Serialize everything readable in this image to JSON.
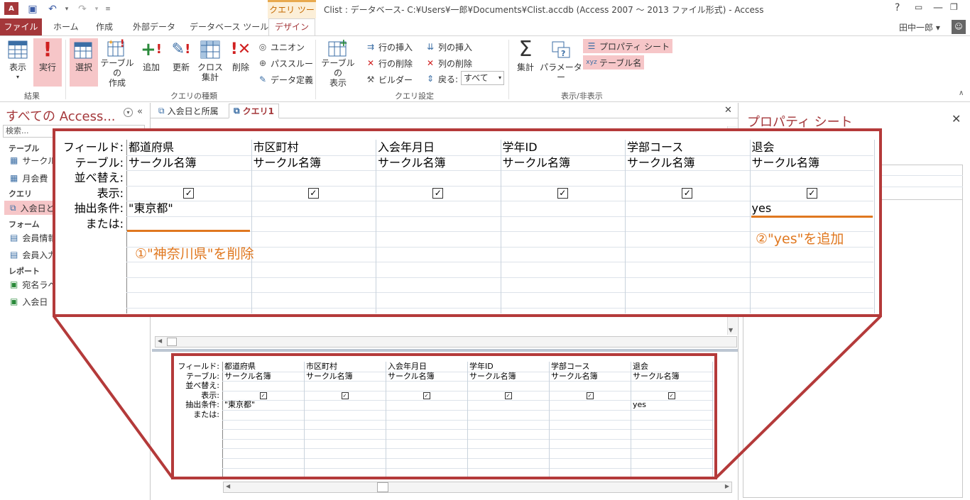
{
  "titlebar": {
    "context_tab": "クエリ ツール",
    "title": "Clist : データベース- C:¥Users¥一郎¥Documents¥Clist.accdb (Access 2007 ～ 2013 ファイル形式) - Access",
    "help": "?",
    "user": "田中一郎"
  },
  "ribbon_tabs": [
    "ファイル",
    "ホーム",
    "作成",
    "外部データ",
    "データベース ツール",
    "デザイン"
  ],
  "ribbon": {
    "groups": {
      "results": "結果",
      "query_type": "クエリの種類",
      "query_setup": "クエリ設定",
      "show_hide": "表示/非表示"
    },
    "view": "表示",
    "run": "実行",
    "select": "選択",
    "make_table_1": "テーブルの",
    "make_table_2": "作成",
    "append": "追加",
    "update": "更新",
    "crosstab_1": "クロス",
    "crosstab_2": "集計",
    "delete": "削除",
    "union": "ユニオン",
    "passthrough": "パススルー",
    "data_definition": "データ定義",
    "show_table_1": "テーブルの",
    "show_table_2": "表示",
    "insert_rows": "行の挿入",
    "delete_rows": "行の削除",
    "builder": "ビルダー",
    "insert_cols": "列の挿入",
    "delete_cols": "列の削除",
    "return_label": "戻る:",
    "return_value": "すべて",
    "totals": "集計",
    "parameters": "パラメーター",
    "property_sheet": "プロパティ シート",
    "table_names": "テーブル名"
  },
  "nav": {
    "title": "すべての Access...",
    "search": "検索...",
    "groups": [
      {
        "label": "テーブル",
        "items": [
          "サークル名簿",
          "月会費"
        ]
      },
      {
        "label": "クエリ",
        "items": [
          "入会日と所属"
        ]
      },
      {
        "label": "フォーム",
        "items": [
          "会員情報",
          "会員入力"
        ]
      },
      {
        "label": "レポート",
        "items": [
          "宛名ラベル",
          "入会日"
        ]
      }
    ]
  },
  "doc_tabs": [
    "入会日と所属",
    "クエリ1"
  ],
  "property_sheet": {
    "title": "プロパティ シート"
  },
  "grid": {
    "row_labels": [
      "フィールド:",
      "テーブル:",
      "並べ替え:",
      "表示:",
      "抽出条件:",
      "または:"
    ],
    "columns": [
      {
        "field": "都道府県",
        "table": "サークル名簿",
        "show": true,
        "criteria": "\"東京都\""
      },
      {
        "field": "市区町村",
        "table": "サークル名簿",
        "show": true,
        "criteria": ""
      },
      {
        "field": "入会年月日",
        "table": "サークル名簿",
        "show": true,
        "criteria": ""
      },
      {
        "field": "学年ID",
        "table": "サークル名簿",
        "show": true,
        "criteria": ""
      },
      {
        "field": "学部コース",
        "table": "サークル名簿",
        "show": true,
        "criteria": ""
      },
      {
        "field": "退会",
        "table": "サークル名簿",
        "show": true,
        "criteria": "yes"
      }
    ]
  },
  "annotations": {
    "note1": "①\"神奈川県\"を削除",
    "note2": "②\"yes\"を追加",
    "frame_color": "#b43a3a",
    "note_color": "#e07820"
  }
}
